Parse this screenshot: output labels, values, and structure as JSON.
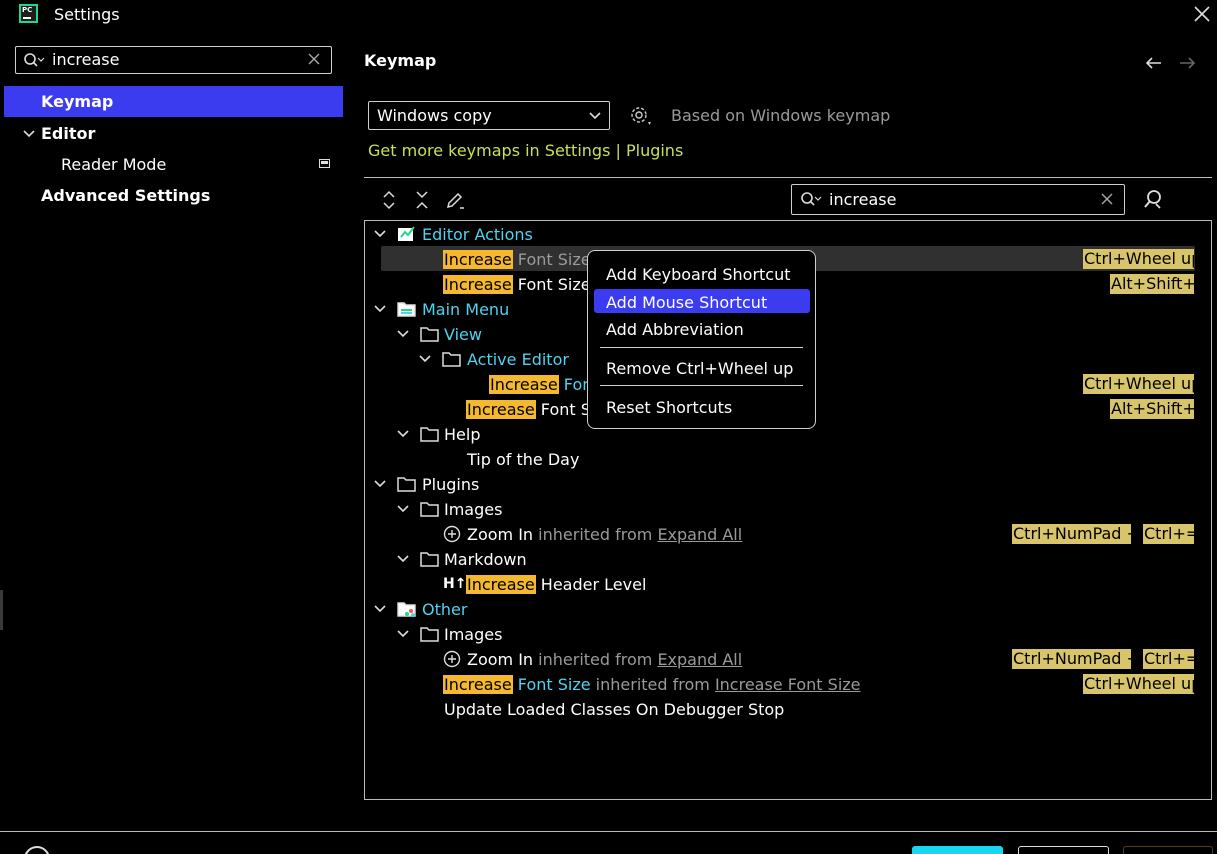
{
  "window": {
    "title": "Settings",
    "logo_text": "PC"
  },
  "left": {
    "search_value": "increase",
    "nav": {
      "keymap": "Keymap",
      "editor": "Editor",
      "reader_mode": "Reader Mode",
      "advanced": "Advanced Settings"
    }
  },
  "main": {
    "title": "Keymap",
    "keymap_selected": "Windows copy",
    "based_on": "Based on Windows keymap",
    "get_more": "Get more keymaps in Settings | Plugins",
    "search_value": "increase"
  },
  "tree": {
    "editor_actions": "Editor Actions",
    "increase": "Increase",
    "font_size": " Font Size",
    "main_menu": "Main Menu",
    "view": "View",
    "active_editor": "Active Editor",
    "fon_trunc": " Fon",
    "font_s_trunc": " Font S",
    "help": "Help",
    "tip_of_day": "Tip of the Day",
    "plugins": "Plugins",
    "images": "Images",
    "zoom_in": "Zoom In",
    "inherited_from": " inherited from ",
    "expand_all": "Expand All",
    "markdown": "Markdown",
    "header_level": " Header Level",
    "header_icon": "H↑",
    "other": "Other",
    "font_size_cyan": " Font Size",
    "increase_font_size_link": "Increase Font Size",
    "update_loaded": "Update Loaded Classes On Debugger Stop"
  },
  "shortcuts": {
    "ctrl_wheel_up": "Ctrl+Wheel up",
    "alt_shift": "Alt+Shift+.",
    "ctrl_numpad_plus": "Ctrl+NumPad +",
    "ctrl_eq": "Ctrl+="
  },
  "popup": {
    "add_keyboard": "Add Keyboard Shortcut",
    "add_mouse": "Add Mouse Shortcut",
    "add_abbrev": "Add Abbreviation",
    "remove": "Remove Ctrl+Wheel up",
    "reset": "Reset Shortcuts"
  },
  "colors": {
    "accent": "#3b3bf0",
    "highlight": "#f5b82e",
    "shortcut_bg": "#d8c46a",
    "link_cyan": "#4fd3f0",
    "get_more": "#c8e05a"
  }
}
